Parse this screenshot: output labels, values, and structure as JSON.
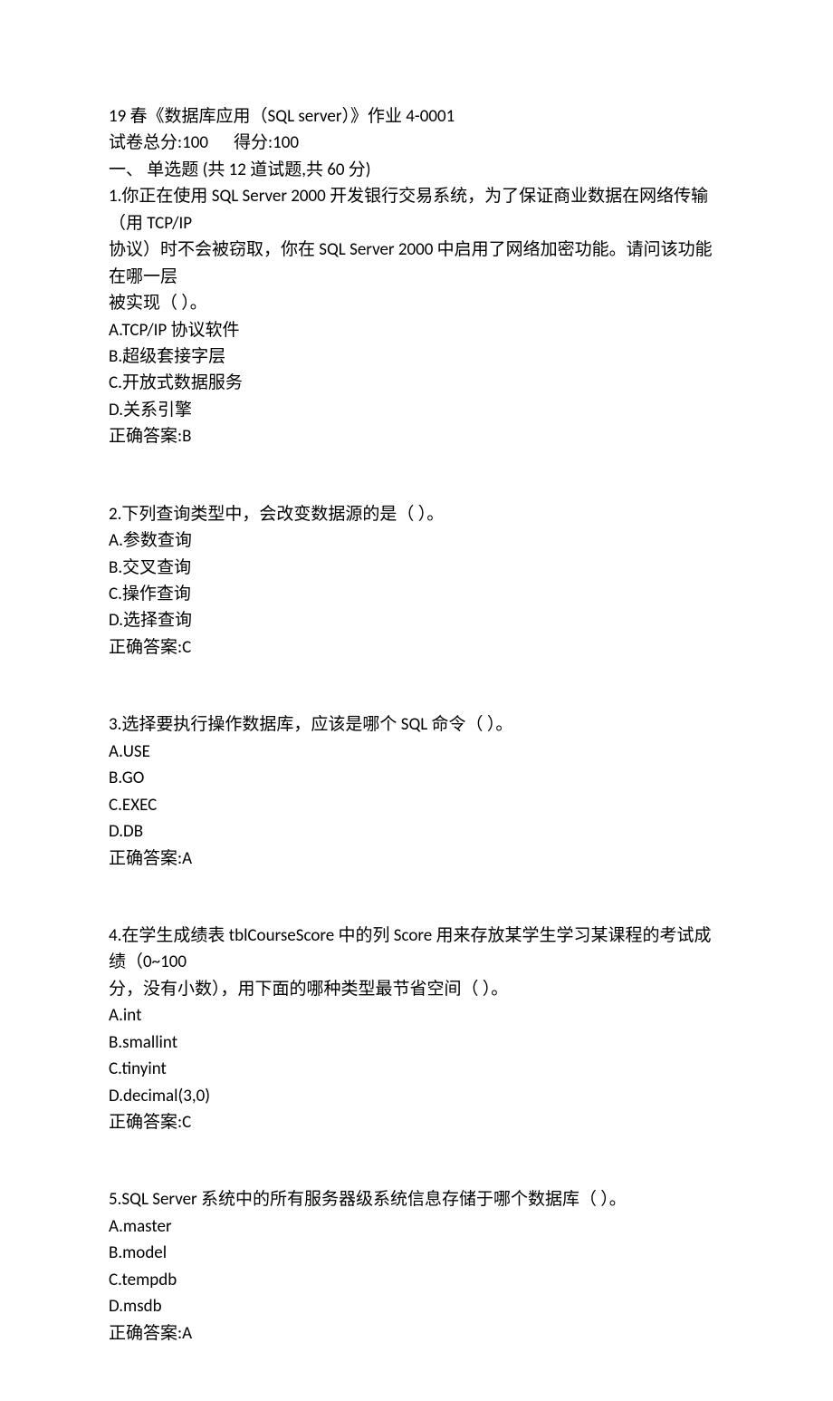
{
  "header": {
    "title": "19 春《数据库应用（SQL server）》作业 4-0001",
    "total_label": "试卷总分:",
    "total_score": "100",
    "score_label": "得分:",
    "score_value": "100",
    "section_label": "一、  单选题 (共  12  道试题,共  60  分)"
  },
  "answer_label": "正确答案:",
  "questions": [
    {
      "stem_lines": [
        "1.你正在使用 SQL Server 2000 开发银行交易系统，为了保证商业数据在网络传输（用 TCP/IP",
        "协议）时不会被窃取，你在 SQL Server 2000 中启用了网络加密功能。请问该功能在哪一层",
        "被实现（ ）。"
      ],
      "options": [
        "A.TCP/IP 协议软件",
        "B.超级套接字层",
        "C.开放式数据服务",
        "D.关系引擎"
      ],
      "answer": "B"
    },
    {
      "stem_lines": [
        "2.下列查询类型中，会改变数据源的是（ ）。"
      ],
      "options": [
        "A.参数查询",
        "B.交叉查询",
        "C.操作查询",
        "D.选择查询"
      ],
      "answer": "C"
    },
    {
      "stem_lines": [
        "3.选择要执行操作数据库，应该是哪个 SQL 命令（ ）。"
      ],
      "options": [
        "A.USE",
        "B.GO",
        "C.EXEC",
        "D.DB"
      ],
      "answer": "A"
    },
    {
      "stem_lines": [
        "4.在学生成绩表 tblCourseScore 中的列 Score 用来存放某学生学习某课程的考试成绩（0~100",
        "分，没有小数），用下面的哪种类型最节省空间（ ）。"
      ],
      "options": [
        "A.int",
        "B.smallint",
        "C.tinyint",
        "D.decimal(3,0)"
      ],
      "answer": "C"
    },
    {
      "stem_lines": [
        "5.SQL Server 系统中的所有服务器级系统信息存储于哪个数据库（ ）。"
      ],
      "options": [
        "A.master",
        "B.model",
        "C.tempdb",
        "D.msdb"
      ],
      "answer": "A"
    }
  ]
}
